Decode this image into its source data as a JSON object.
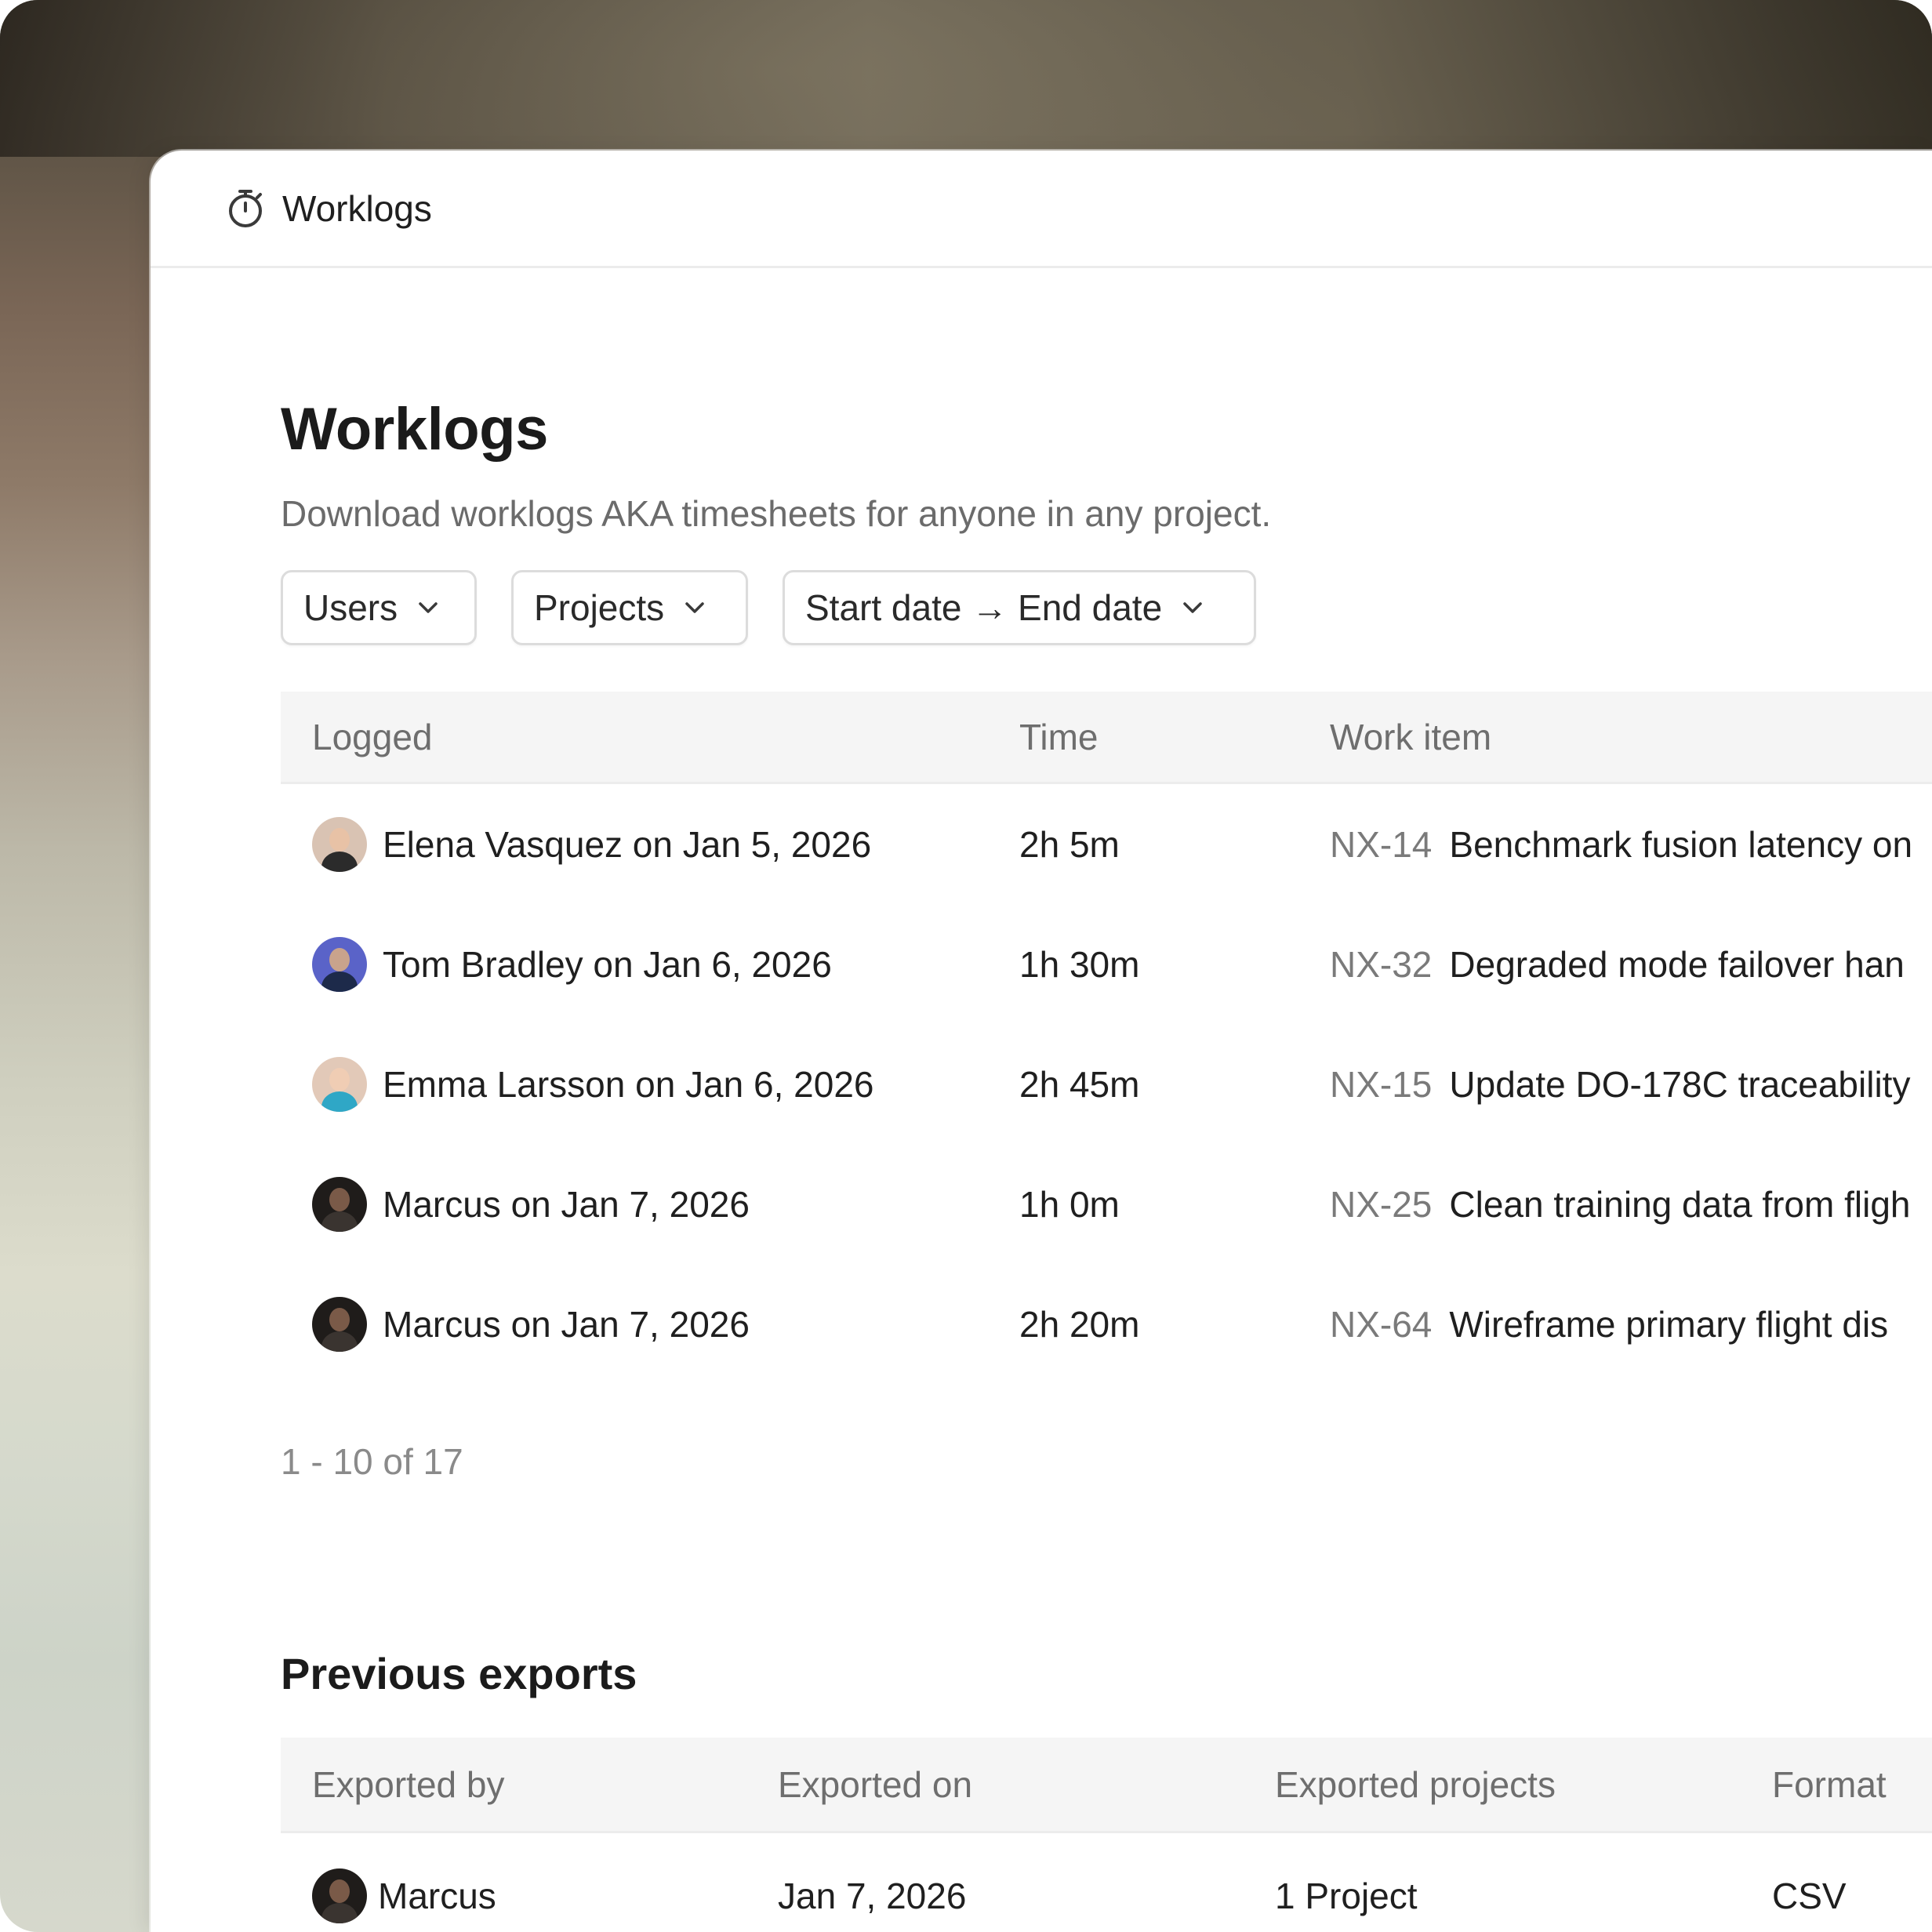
{
  "window": {
    "title": "Worklogs",
    "icon": "stopwatch-icon"
  },
  "page": {
    "title": "Worklogs",
    "subtitle": "Download worklogs AKA timesheets for anyone in any project."
  },
  "filters": {
    "users": "Users",
    "projects": "Projects",
    "date_range": "Start date → End date"
  },
  "worklogs": {
    "columns": {
      "logged": "Logged",
      "time": "Time",
      "work_item": "Work item"
    },
    "rows": [
      {
        "logged": "Elena Vasquez on Jan 5, 2026",
        "time": "2h 5m",
        "key": "NX-14",
        "summary": "Benchmark fusion latency on"
      },
      {
        "logged": "Tom Bradley on Jan 6, 2026",
        "time": "1h 30m",
        "key": "NX-32",
        "summary": "Degraded mode failover han"
      },
      {
        "logged": "Emma Larsson on Jan 6, 2026",
        "time": "2h 45m",
        "key": "NX-15",
        "summary": "Update DO-178C traceability"
      },
      {
        "logged": "Marcus on Jan 7, 2026",
        "time": "1h 0m",
        "key": "NX-25",
        "summary": "Clean training data from fligh"
      },
      {
        "logged": "Marcus on Jan 7, 2026",
        "time": "2h 20m",
        "key": "NX-64",
        "summary": "Wireframe primary flight dis"
      }
    ],
    "pagination": "1 - 10 of 17"
  },
  "exports": {
    "title": "Previous exports",
    "columns": {
      "exported_by": "Exported by",
      "exported_on": "Exported on",
      "exported_projects": "Exported projects",
      "format": "Format"
    },
    "rows": [
      {
        "exported_by": "Marcus",
        "exported_on": "Jan 7, 2026",
        "exported_projects": "1 Project",
        "format": "CSV"
      }
    ]
  },
  "colors": {
    "accent_text": "#1f1f1f",
    "muted_text": "#6e6e6e",
    "header_bg": "#f5f5f5",
    "border": "#dcdcdc"
  }
}
